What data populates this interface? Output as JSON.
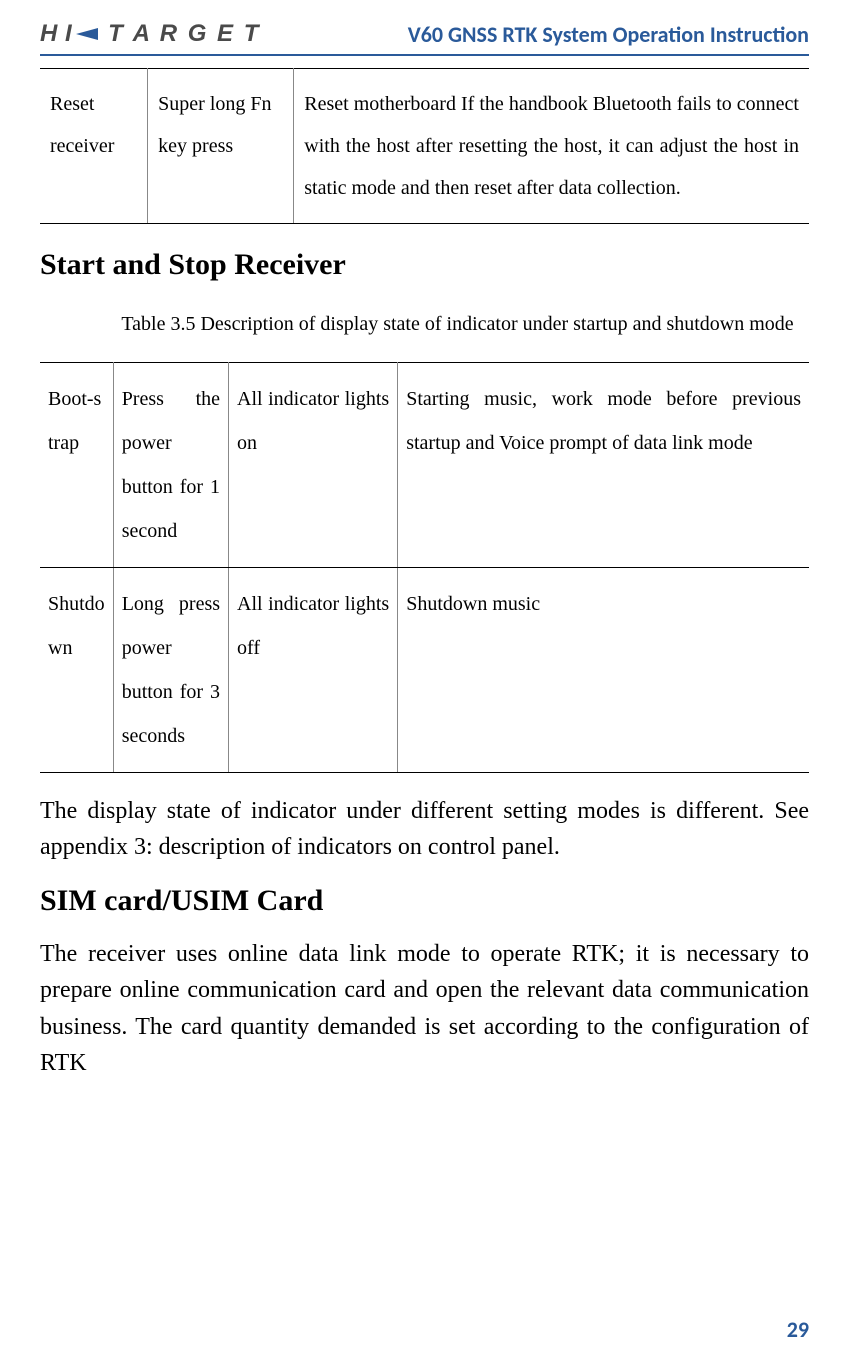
{
  "header": {
    "logo_h": "H I",
    "logo_t": "T A R G E T",
    "doc_title": "V60 GNSS RTK System Operation Instruction"
  },
  "table1": {
    "c1": "Reset receiver",
    "c2": "Super long Fn key press",
    "c3": "Reset motherboard If the handbook Bluetooth fails to connect with the host after resetting the host, it can adjust the host in static mode and then reset after data collection."
  },
  "section1_heading": "Start and Stop Receiver",
  "table2_caption": "Table 3.5 Description of display state of indicator under startup and shutdown mode",
  "table2": {
    "row1": {
      "c1": "Boot-s trap",
      "c2": "Press the power button for 1 second",
      "c3": "All indicator lights on",
      "c4": "Starting music, work mode before previous startup and Voice prompt of data link mode"
    },
    "row2": {
      "c1": "Shutdo wn",
      "c2": "Long press power button for 3 seconds",
      "c3": "All indicator lights off",
      "c4": "Shutdown music"
    }
  },
  "para1": "The display state of indicator under different setting modes is different. See appendix 3: description of indicators on control panel.",
  "section2_heading": "SIM card/USIM Card",
  "para2": "The receiver uses online data link mode to operate RTK; it is necessary to prepare online communication card and open the relevant data communication business. The card quantity demanded is set according to the configuration of RTK",
  "page_number": "29"
}
